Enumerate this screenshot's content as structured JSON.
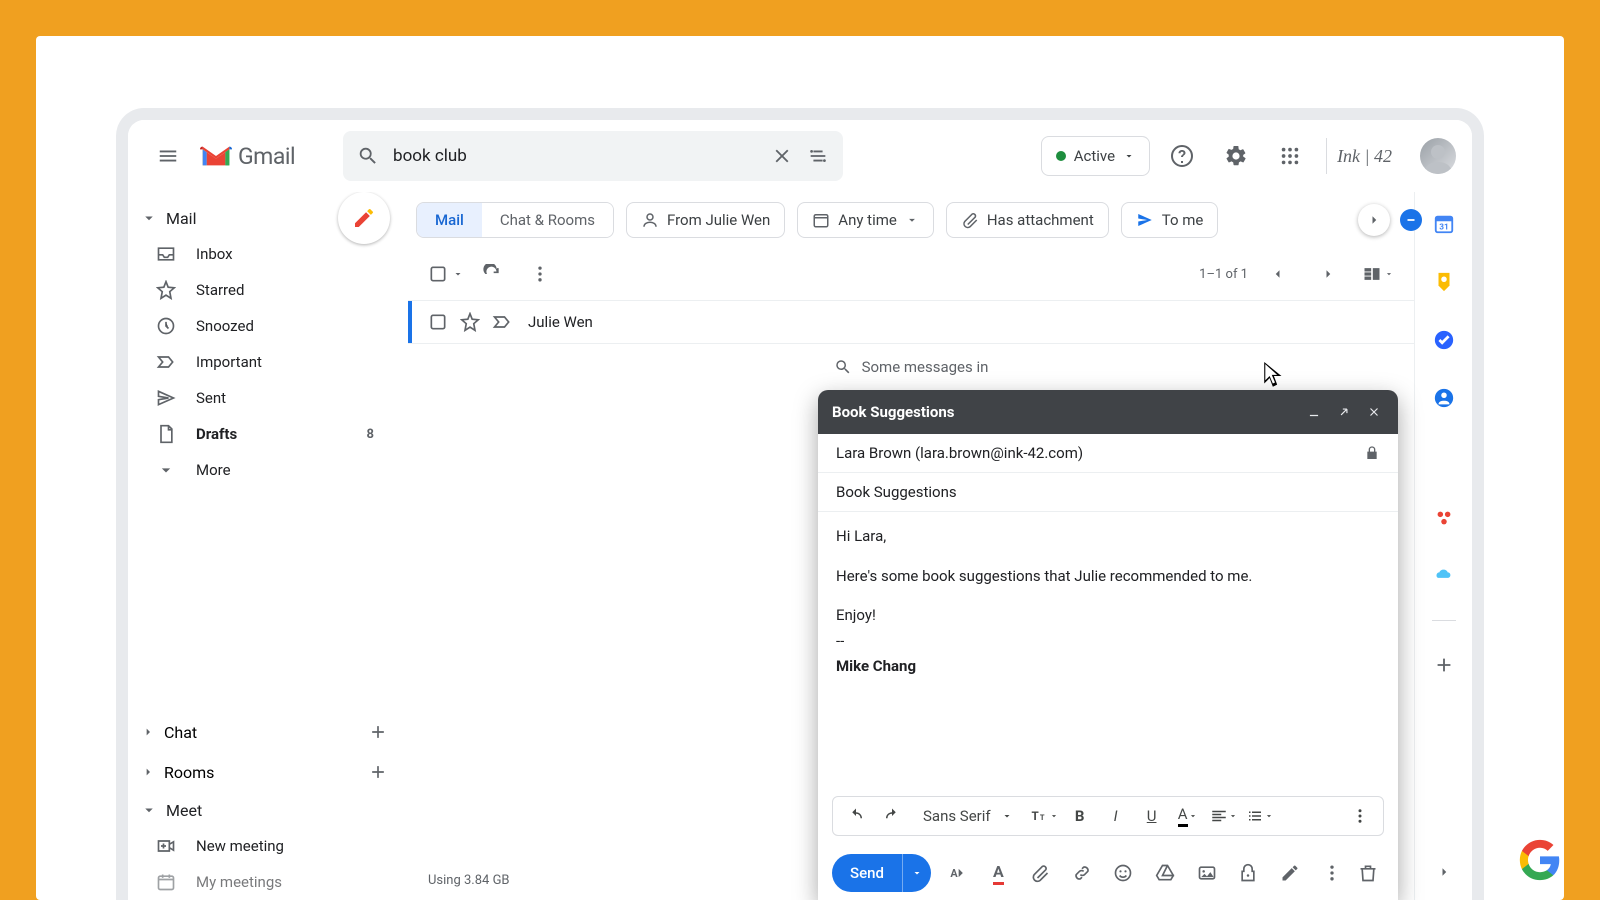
{
  "header": {
    "product": "Gmail",
    "search_value": "book club",
    "status_label": "Active",
    "workspace": "Ink | 42"
  },
  "sidebar": {
    "mail_label": "Mail",
    "items": {
      "inbox": "Inbox",
      "starred": "Starred",
      "snoozed": "Snoozed",
      "important": "Important",
      "sent": "Sent",
      "drafts": "Drafts",
      "drafts_count": "8",
      "more": "More"
    },
    "chat_label": "Chat",
    "rooms_label": "Rooms",
    "meet_label": "Meet",
    "new_meeting": "New meeting",
    "my_meetings": "My meetings"
  },
  "filters": {
    "seg_mail": "Mail",
    "seg_chat": "Chat & Rooms",
    "from": "From Julie Wen",
    "time": "Any time",
    "attach": "Has attachment",
    "tome": "To me"
  },
  "list": {
    "pager": "1–1 of 1",
    "sender": "Julie Wen",
    "hint": "Some messages in"
  },
  "footer": {
    "storage": "Using 3.84 GB"
  },
  "compose": {
    "title": "Book Suggestions",
    "to": "Lara Brown (lara.brown@ink-42.com)",
    "subject": "Book Suggestions",
    "body_greeting": "Hi Lara,",
    "body_line": "Here's some book suggestions that Julie recommended to me.",
    "body_close": "Enjoy!",
    "sig_sep": "--",
    "sig_name": "Mike Chang",
    "font": "Sans Serif",
    "send": "Send"
  }
}
